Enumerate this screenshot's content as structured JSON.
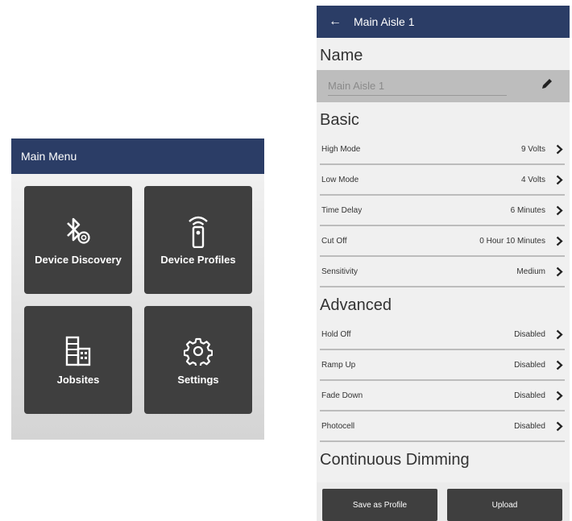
{
  "main_menu": {
    "title": "Main Menu",
    "tiles": [
      {
        "label": "Device Discovery",
        "icon": "bluetooth-search-icon"
      },
      {
        "label": "Device Profiles",
        "icon": "remote-signal-icon"
      },
      {
        "label": "Jobsites",
        "icon": "buildings-icon"
      },
      {
        "label": "Settings",
        "icon": "gear-icon"
      }
    ]
  },
  "detail": {
    "back_icon": "←",
    "title": "Main Aisle 1",
    "name_section": "Name",
    "name_value": "Main Aisle 1",
    "basic_section": "Basic",
    "basic_rows": [
      {
        "label": "High Mode",
        "value": "9 Volts"
      },
      {
        "label": "Low Mode",
        "value": "4 Volts"
      },
      {
        "label": "Time Delay",
        "value": "6 Minutes"
      },
      {
        "label": "Cut Off",
        "value": "0 Hour 10 Minutes"
      },
      {
        "label": "Sensitivity",
        "value": "Medium"
      }
    ],
    "advanced_section": "Advanced",
    "advanced_rows": [
      {
        "label": "Hold Off",
        "value": "Disabled"
      },
      {
        "label": "Ramp Up",
        "value": "Disabled"
      },
      {
        "label": "Fade Down",
        "value": "Disabled"
      },
      {
        "label": "Photocell",
        "value": "Disabled"
      }
    ],
    "continuous_section": "Continuous Dimming",
    "buttons": {
      "save_profile": "Save as Profile",
      "upload": "Upload"
    }
  },
  "colors": {
    "app_bar": "#2b3d66",
    "tile": "#3f3f3f",
    "button": "#3f3f3f"
  }
}
